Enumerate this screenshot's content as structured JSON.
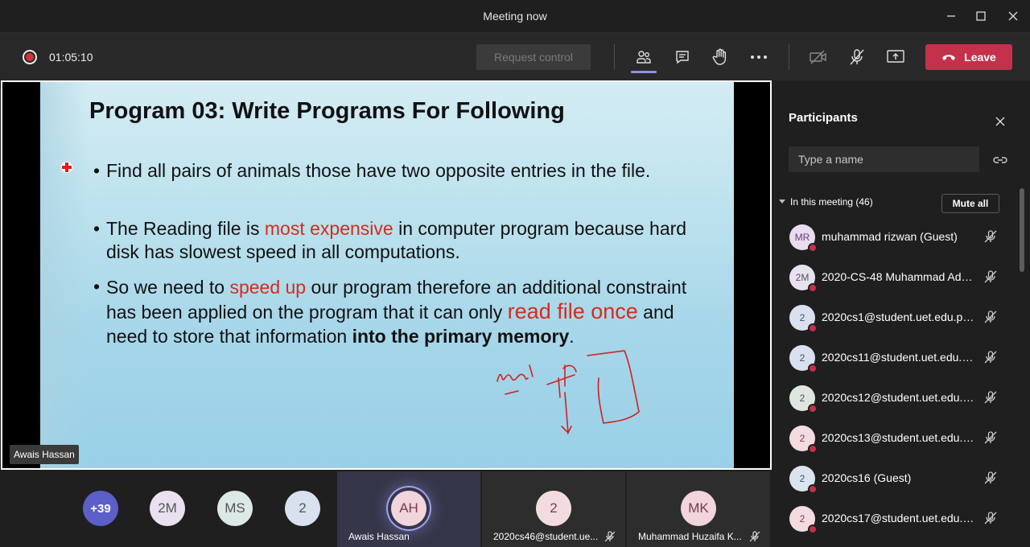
{
  "window": {
    "title": "Meeting now"
  },
  "toolbar": {
    "timer": "01:05:10",
    "request_control": "Request control",
    "leave_label": "Leave",
    "colors": {
      "leave": "#c4314b",
      "accent": "#8f91e3"
    }
  },
  "slide": {
    "title": "Program 03: Write Programs For Following",
    "bullet_char": "•",
    "b1": "Find all pairs of animals those have two opposite entries in the file.",
    "b2_a": "The Reading file is ",
    "b2_red": "most expensive",
    "b2_b": " in computer program because hard disk has slowest speed in all computations.",
    "b3_a": "So we need to ",
    "b3_red": "speed up",
    "b3_b": " our program therefore an additional constraint has been applied on the program that it can only ",
    "b3_bigred": "read file once",
    "b3_c": " and need to store that information ",
    "b3_bold": "into the primary memory",
    "b3_end": "."
  },
  "presenter": {
    "name": "Awais Hassan"
  },
  "gallery": {
    "overflow": "+39",
    "avatars": [
      "2M",
      "MS",
      "2"
    ],
    "tiles": [
      {
        "initials": "AH",
        "name": "Awais Hassan"
      },
      {
        "initials": "2",
        "name": "2020cs46@student.ue..."
      },
      {
        "initials": "MK",
        "name": "Muhammad Huzaifa K..."
      }
    ]
  },
  "panel": {
    "title": "Participants",
    "search_placeholder": "Type a name",
    "section": "In this meeting (46)",
    "mute_all": "Mute all",
    "participants": [
      {
        "initials": "MR",
        "name": "muhammad rizwan (Guest)"
      },
      {
        "initials": "2M",
        "name": "2020-CS-48 Muhammad Ade..."
      },
      {
        "initials": "2",
        "name": "2020cs1@student.uet.edu.pk ..."
      },
      {
        "initials": "2",
        "name": "2020cs11@student.uet.edu.p..."
      },
      {
        "initials": "2",
        "name": "2020cs12@student.uet.edu.p..."
      },
      {
        "initials": "2",
        "name": "2020cs13@student.uet.edu.p..."
      },
      {
        "initials": "2",
        "name": "2020cs16 (Guest)"
      },
      {
        "initials": "2",
        "name": "2020cs17@student.uet.edu.p..."
      }
    ]
  }
}
